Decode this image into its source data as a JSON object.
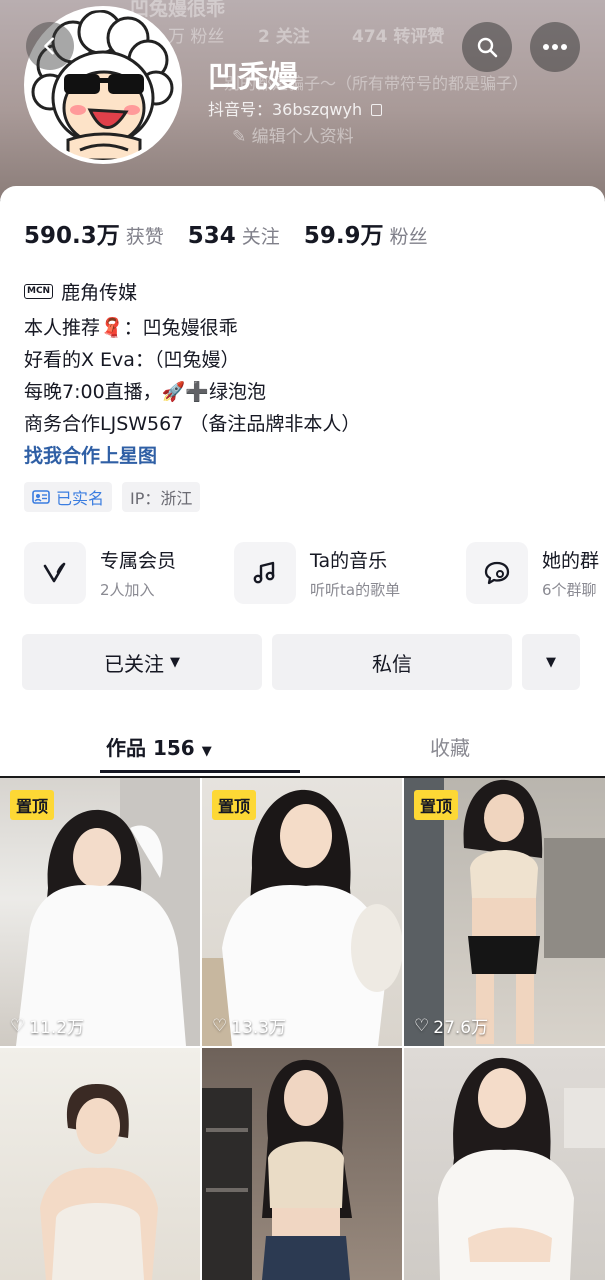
{
  "header": {
    "ghost_name": "凹兔嫚很乖",
    "ghost_fans_suffix": "万 粉丝",
    "ghost_following": "2 关注",
    "ghost_reposts": "474 转评赞",
    "ghost_bio": "别的都是骗子～（所有带符号的都是骗子）",
    "nickname": "凹秃嫚",
    "douyin_id": "抖音号：36bszqwyh",
    "edit_profile": "编辑个人资料"
  },
  "stats": {
    "likes_num": "590.3万",
    "likes_label": "获赞",
    "following_num": "534",
    "following_label": "关注",
    "fans_num": "59.9万",
    "fans_label": "粉丝"
  },
  "mcn": {
    "badge": "MCN",
    "name": "鹿角传媒"
  },
  "bio": {
    "line1": "本人推荐🧣：凹兔嫚很乖",
    "line2": "好看的X Eva：（凹兔嫚）",
    "line3": "每晚7:00直播，🚀➕绿泡泡",
    "line4": "商务合作LJSW567 （备注品牌非本人）",
    "link": "找我合作上星图"
  },
  "tags": {
    "verified": "已实名",
    "ip": "IP：浙江"
  },
  "features": [
    {
      "title": "专属会员",
      "sub": "2人加入",
      "icon": "v-icon"
    },
    {
      "title": "Ta的音乐",
      "sub": "听听ta的歌单",
      "icon": "music-note-icon"
    },
    {
      "title": "她的群",
      "sub": "6个群聊",
      "icon": "chat-bubble-icon"
    }
  ],
  "actions": {
    "followed": "已关注",
    "message": "私信"
  },
  "tabs": {
    "works": "作品 156",
    "favorites": "收藏"
  },
  "grid": [
    {
      "pinned": true,
      "likes": "11.2万"
    },
    {
      "pinned": true,
      "likes": "13.3万"
    },
    {
      "pinned": true,
      "likes": "27.6万"
    },
    {
      "pinned": false,
      "likes": ""
    },
    {
      "pinned": false,
      "likes": ""
    },
    {
      "pinned": false,
      "likes": ""
    }
  ],
  "pin_label": "置顶",
  "colors": {
    "link": "#2f5fa5",
    "pin": "#fdd835",
    "verified": "#3b7de0"
  }
}
